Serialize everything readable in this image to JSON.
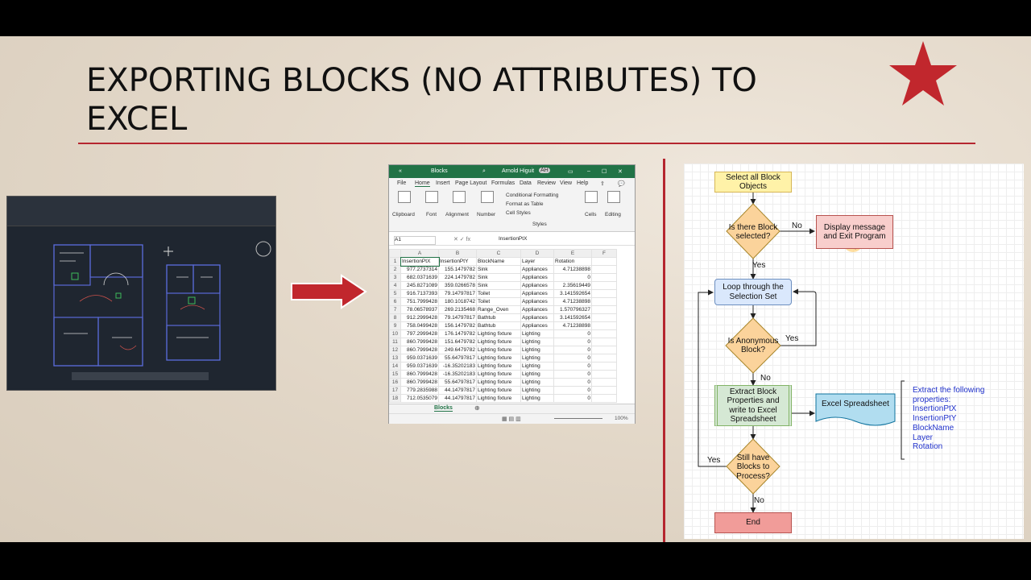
{
  "slide": {
    "title_line1": "EXPORTING BLOCKS (NO ATTRIBUTES) TO",
    "title_line2": "EXCEL",
    "accent_color": "#b5262f"
  },
  "excel": {
    "sheet_name": "Blocks",
    "user_name": "Arnold Higuit",
    "user_initials": "AH",
    "tabs": [
      "File",
      "Home",
      "Insert",
      "Page Layout",
      "Formulas",
      "Data",
      "Review",
      "View",
      "Help"
    ],
    "groups": [
      "Clipboard",
      "Font",
      "Alignment",
      "Number",
      "Cells",
      "Editing",
      "Styles"
    ],
    "style_items": [
      "Conditional Formatting",
      "Format as Table",
      "Cell Styles"
    ],
    "name_box": "A1",
    "formula": "InsertionPtX",
    "zoom": "100%",
    "columns": [
      "A",
      "B",
      "C",
      "D",
      "E",
      "F"
    ],
    "header": [
      "InsertionPtX",
      "InsertionPtY",
      "BlockName",
      "Layer",
      "Rotation"
    ],
    "rows": [
      [
        "977.2737314",
        "155.1479782",
        "Sink",
        "Appliances",
        "4.71238898"
      ],
      [
        "682.0371639",
        "224.1479782",
        "Sink",
        "Appliances",
        "0"
      ],
      [
        "245.8271089",
        "359.0266578",
        "Sink",
        "Appliances",
        "2.35619449"
      ],
      [
        "916.7137393",
        "79.14797817",
        "Toilet",
        "Appliances",
        "3.141592654"
      ],
      [
        "751.7999428",
        "180.1018742",
        "Toilet",
        "Appliances",
        "4.71238898"
      ],
      [
        "78.06578937",
        "269.2135468",
        "Range_Oven",
        "Appliances",
        "1.570796327"
      ],
      [
        "912.2999428",
        "79.14797817",
        "Bathtub",
        "Appliances",
        "3.141592654"
      ],
      [
        "758.0499428",
        "156.1479782",
        "Bathtub",
        "Appliances",
        "4.71238898"
      ],
      [
        "797.2999428",
        "176.1479782",
        "Lighting fixture",
        "Lighting",
        "0"
      ],
      [
        "860.7999428",
        "151.6479782",
        "Lighting fixture",
        "Lighting",
        "0"
      ],
      [
        "860.7999428",
        "249.6479782",
        "Lighting fixture",
        "Lighting",
        "0"
      ],
      [
        "959.0371639",
        "55.64797817",
        "Lighting fixture",
        "Lighting",
        "0"
      ],
      [
        "959.0371639",
        "-16.35202183",
        "Lighting fixture",
        "Lighting",
        "0"
      ],
      [
        "860.7999428",
        "-16.35202183",
        "Lighting fixture",
        "Lighting",
        "0"
      ],
      [
        "860.7999428",
        "55.64797817",
        "Lighting fixture",
        "Lighting",
        "0"
      ],
      [
        "779.2835988",
        "44.14797817",
        "Lighting fixture",
        "Lighting",
        "0"
      ],
      [
        "712.0535079",
        "44.14797817",
        "Lighting fixture",
        "Lighting",
        "0"
      ]
    ]
  },
  "flow": {
    "start": "Select all Block Objects",
    "d1": "Is there Block selected?",
    "no1": "No",
    "msg": "Display message and Exit Program",
    "yes1": "Yes",
    "loop": "Loop through the Selection Set",
    "d2": "Is Anonymous Block?",
    "yes2": "Yes",
    "no2": "No",
    "extract": "Extract Block Properties and write to Excel Spreadsheet",
    "excel": "Excel Spreadsheet",
    "props_title": "Extract the following properties:",
    "props": [
      "InsertionPtX",
      "InsertionPtY",
      "BlockName",
      "Layer",
      "Rotation"
    ],
    "d3": "Still have Blocks to Process?",
    "yes3": "Yes",
    "no3": "No",
    "end": "End"
  }
}
